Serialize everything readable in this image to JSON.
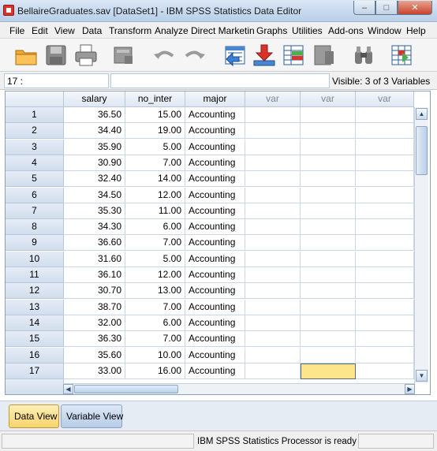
{
  "window": {
    "title": "BellaireGraduates.sav [DataSet1] - IBM SPSS Statistics Data Editor",
    "minimize": "–",
    "maximize": "□",
    "close": "✕"
  },
  "menu": [
    "File",
    "Edit",
    "View",
    "Data",
    "Transform",
    "Analyze",
    "Direct Marketing",
    "Graphs",
    "Utilities",
    "Add-ons",
    "Window",
    "Help"
  ],
  "toolbar": {
    "icons": [
      "open-folder-icon",
      "save-icon",
      "print-icon",
      "dialog-recall-icon",
      "undo-icon",
      "redo-icon",
      "go-to-case-icon",
      "go-to-variable-icon",
      "variables-icon",
      "split-file-icon",
      "find-icon",
      "insert-cases-icon"
    ]
  },
  "cellbar": {
    "reference": "17 :",
    "value": "",
    "visible": "Visible: 3 of 3 Variables"
  },
  "grid": {
    "columns": [
      "salary",
      "no_inter",
      "major",
      "var",
      "var",
      "var"
    ],
    "rows": [
      {
        "id": "1",
        "salary": "36.50",
        "no_inter": "15.00",
        "major": "Accounting"
      },
      {
        "id": "2",
        "salary": "34.40",
        "no_inter": "19.00",
        "major": "Accounting"
      },
      {
        "id": "3",
        "salary": "35.90",
        "no_inter": "5.00",
        "major": "Accounting"
      },
      {
        "id": "4",
        "salary": "30.90",
        "no_inter": "7.00",
        "major": "Accounting"
      },
      {
        "id": "5",
        "salary": "32.40",
        "no_inter": "14.00",
        "major": "Accounting"
      },
      {
        "id": "6",
        "salary": "34.50",
        "no_inter": "12.00",
        "major": "Accounting"
      },
      {
        "id": "7",
        "salary": "35.30",
        "no_inter": "11.00",
        "major": "Accounting"
      },
      {
        "id": "8",
        "salary": "34.30",
        "no_inter": "6.00",
        "major": "Accounting"
      },
      {
        "id": "9",
        "salary": "36.60",
        "no_inter": "7.00",
        "major": "Accounting"
      },
      {
        "id": "10",
        "salary": "31.60",
        "no_inter": "5.00",
        "major": "Accounting"
      },
      {
        "id": "11",
        "salary": "36.10",
        "no_inter": "12.00",
        "major": "Accounting"
      },
      {
        "id": "12",
        "salary": "30.70",
        "no_inter": "13.00",
        "major": "Accounting"
      },
      {
        "id": "13",
        "salary": "38.70",
        "no_inter": "7.00",
        "major": "Accounting"
      },
      {
        "id": "14",
        "salary": "32.00",
        "no_inter": "6.00",
        "major": "Accounting"
      },
      {
        "id": "15",
        "salary": "36.30",
        "no_inter": "7.00",
        "major": "Accounting"
      },
      {
        "id": "16",
        "salary": "35.60",
        "no_inter": "10.00",
        "major": "Accounting"
      },
      {
        "id": "17",
        "salary": "33.00",
        "no_inter": "16.00",
        "major": "Accounting"
      }
    ],
    "selected": {
      "row": "17",
      "column": "var"
    }
  },
  "tabs": {
    "data_view": "Data View",
    "variable_view": "Variable View",
    "active": "Data View"
  },
  "status": {
    "text": "IBM SPSS Statistics Processor is ready"
  },
  "colors": {
    "selected_cell": "#fde58c",
    "active_tab": "#f7d46a",
    "header": "#dfe7f1"
  }
}
